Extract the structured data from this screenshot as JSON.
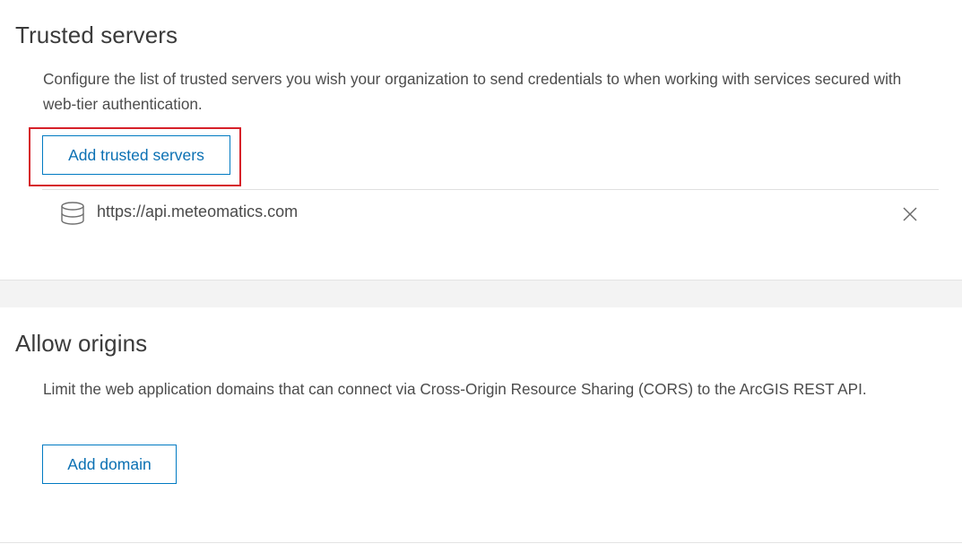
{
  "trusted_servers": {
    "title": "Trusted servers",
    "description": "Configure the list of trusted servers you wish your organization to send credentials to when working with services secured with web-tier authentication.",
    "add_button_label": "Add trusted servers",
    "servers": [
      {
        "url": "https://api.meteomatics.com",
        "icon": "database-icon",
        "remove_icon": "close-icon"
      }
    ]
  },
  "allow_origins": {
    "title": "Allow origins",
    "description": "Limit the web application domains that can connect via Cross-Origin Resource Sharing (CORS) to the ArcGIS REST API.",
    "add_button_label": "Add domain"
  },
  "colors": {
    "accent": "#007ac2",
    "highlight": "#d62029",
    "section_gap": "#f3f3f3"
  }
}
